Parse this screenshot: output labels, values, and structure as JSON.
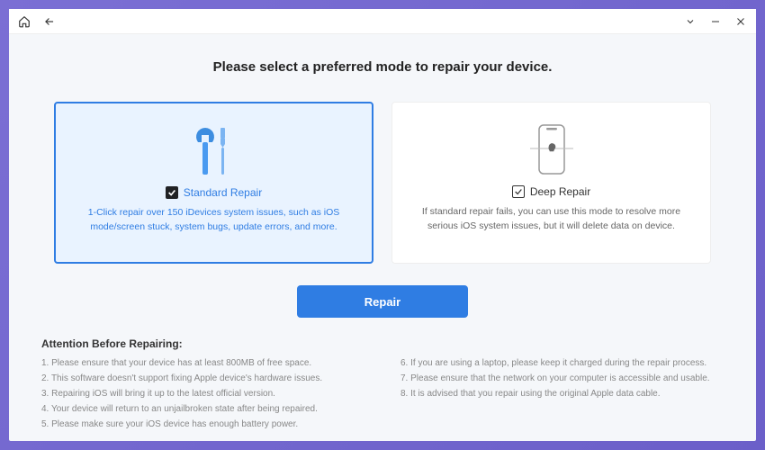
{
  "heading": "Please select a preferred mode to repair your device.",
  "cards": {
    "standard": {
      "title": "Standard Repair",
      "desc": "1-Click repair over 150 iDevices system issues, such as iOS mode/screen stuck, system bugs, update errors, and more."
    },
    "deep": {
      "title": "Deep Repair",
      "desc": "If standard repair fails, you can use this mode to resolve more serious iOS system issues, but it will delete data on device."
    }
  },
  "repair_button": "Repair",
  "attention_heading": "Attention Before Repairing:",
  "attention_left": [
    "1. Please ensure that your device has at least 800MB of free space.",
    "2. This software doesn't support fixing Apple device's hardware issues.",
    "3. Repairing iOS will bring it up to the latest official version.",
    "4. Your device will return to an unjailbroken state after being repaired.",
    "5. Please make sure your iOS device has enough battery power."
  ],
  "attention_right": [
    "6. If you are using a laptop, please keep it charged during the repair process.",
    "7. Please ensure that the network on your computer is accessible and usable.",
    "8. It is advised that you repair using the original Apple data cable."
  ]
}
